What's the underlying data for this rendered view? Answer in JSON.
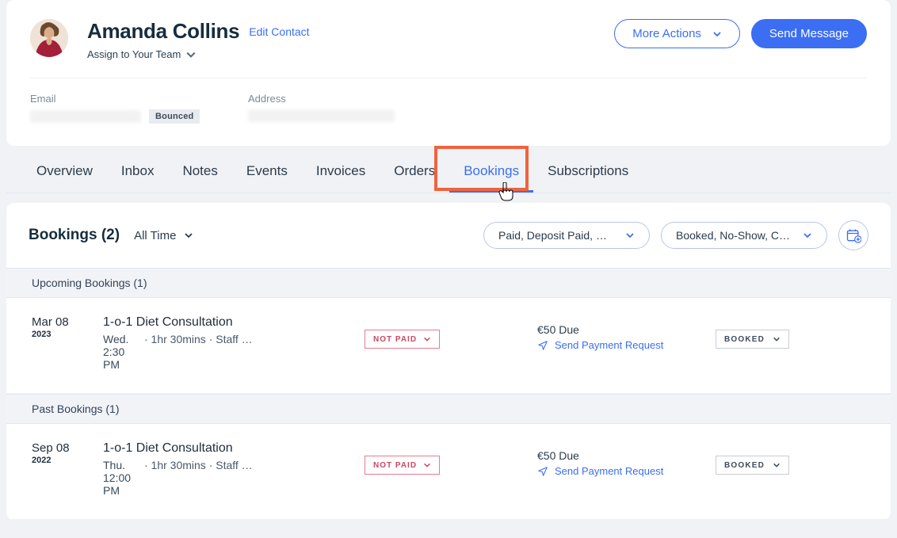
{
  "header": {
    "name": "Amanda Collins",
    "edit": "Edit Contact",
    "assign": "Assign to Your Team",
    "more_actions": "More Actions",
    "send_message": "Send Message",
    "email_label": "Email",
    "bounced_badge": "Bounced",
    "address_label": "Address"
  },
  "tabs": {
    "overview": "Overview",
    "inbox": "Inbox",
    "notes": "Notes",
    "events": "Events",
    "invoices": "Invoices",
    "orders": "Orders",
    "bookings": "Bookings",
    "subscriptions": "Subscriptions"
  },
  "bookings": {
    "title": "Bookings (2)",
    "time_filter": "All Time",
    "payment_filter": "Paid, Deposit Paid, …",
    "status_filter": "Booked, No-Show, C…",
    "upcoming_label": "Upcoming Bookings (1)",
    "past_label": "Past Bookings (1)"
  },
  "rows": [
    {
      "date_main": "Mar 08",
      "date_year": "2023",
      "svc": "1-o-1 Diet Consultation",
      "day": "Wed.",
      "meta": "· 1hr 30mins · Staff …",
      "time": "2:30 PM",
      "pay_pill": "NOT PAID",
      "due": "€50 Due",
      "pay_link": "Send Payment Request",
      "status_pill": "BOOKED"
    },
    {
      "date_main": "Sep 08",
      "date_year": "2022",
      "svc": "1-o-1 Diet Consultation",
      "day": "Thu.",
      "meta": "· 1hr 30mins · Staff …",
      "time": "12:00 PM",
      "pay_pill": "NOT PAID",
      "due": "€50 Due",
      "pay_link": "Send Payment Request",
      "status_pill": "BOOKED"
    }
  ]
}
